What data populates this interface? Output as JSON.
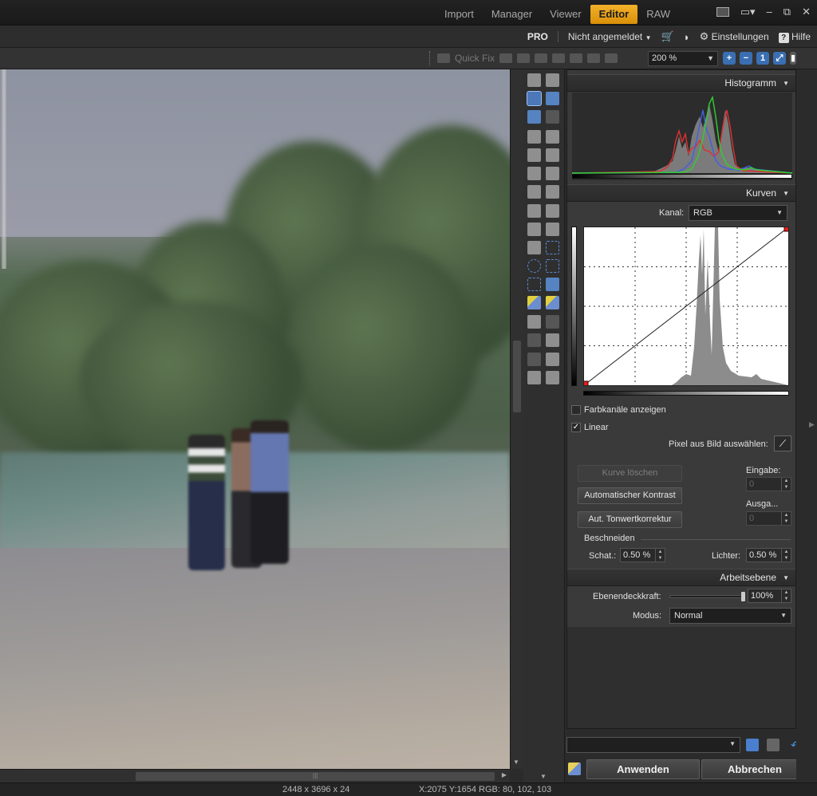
{
  "tabs": [
    {
      "label": "Import",
      "active": false
    },
    {
      "label": "Manager",
      "active": false
    },
    {
      "label": "Viewer",
      "active": false
    },
    {
      "label": "Editor",
      "active": true
    },
    {
      "label": "RAW",
      "active": false
    }
  ],
  "window_controls": {
    "minimize": "–",
    "restore": "⧉",
    "close": "✕"
  },
  "account": {
    "edition": "PRO",
    "login_status": "Nicht angemeldet",
    "settings_label": "Einstellungen",
    "help_label": "Hilfe"
  },
  "toolbar": {
    "quick_fix_label": "Quick Fix",
    "zoom_value": "200 %",
    "zoom_icons": [
      "zoom-in-icon",
      "zoom-out-icon",
      "actual-size-icon",
      "fit-icon",
      "full-screen-icon"
    ]
  },
  "panel": {
    "histogram_title": "Histogramm",
    "curves_title": "Kurven",
    "channel_label": "Kanal:",
    "channel_value": "RGB",
    "show_channels_label": "Farbkanäle anzeigen",
    "show_channels_checked": false,
    "linear_label": "Linear",
    "linear_checked": true,
    "pick_pixel_label": "Pixel aus Bild auswählen:",
    "clear_curve_button": "Kurve löschen",
    "auto_contrast_button": "Automatischer Kontrast",
    "auto_levels_button": "Aut. Tonwertkorrektur",
    "input_label": "Eingabe:",
    "input_value": "0",
    "output_label": "Ausga...",
    "output_value": "0",
    "clipping_label": "Beschneiden",
    "shadows_label": "Schat.:",
    "shadows_value": "0.50 %",
    "highlights_label": "Lichter:",
    "highlights_value": "0.50 %",
    "layer_title": "Arbeitsebene",
    "opacity_label": "Ebenendeckkraft:",
    "opacity_value": "100%",
    "opacity_level": 1.0,
    "mode_label": "Modus:",
    "mode_value": "Normal"
  },
  "actions": {
    "apply_button": "Anwenden",
    "cancel_button": "Abbrechen"
  },
  "status": {
    "dimensions": "2448 x 3696 x 24",
    "coords": "X:2075 Y:1654",
    "rgb": "RGB: 80, 102, 103"
  },
  "colors": {
    "accent": "#e8a317",
    "panel_bg": "#3a3a3a",
    "histo_red": "#e03030",
    "histo_green": "#30d030",
    "histo_blue": "#4060e0"
  }
}
